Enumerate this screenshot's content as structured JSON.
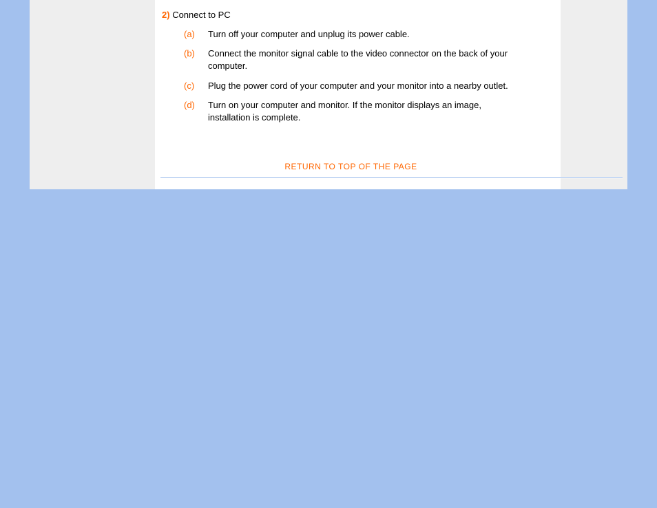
{
  "section": {
    "number": "2)",
    "title": "Connect to PC"
  },
  "steps": [
    {
      "letter": "(a)",
      "text": "Turn off your computer and unplug its power cable."
    },
    {
      "letter": "(b)",
      "text": "Connect the monitor signal cable to the video connector on the back of your computer."
    },
    {
      "letter": "(c)",
      "text": "Plug the power cord of your computer and your monitor into a nearby outlet."
    },
    {
      "letter": "(d)",
      "text": "Turn on your computer and monitor. If the monitor displays an image, installation is complete."
    }
  ],
  "returnLink": "RETURN TO TOP OF THE PAGE"
}
